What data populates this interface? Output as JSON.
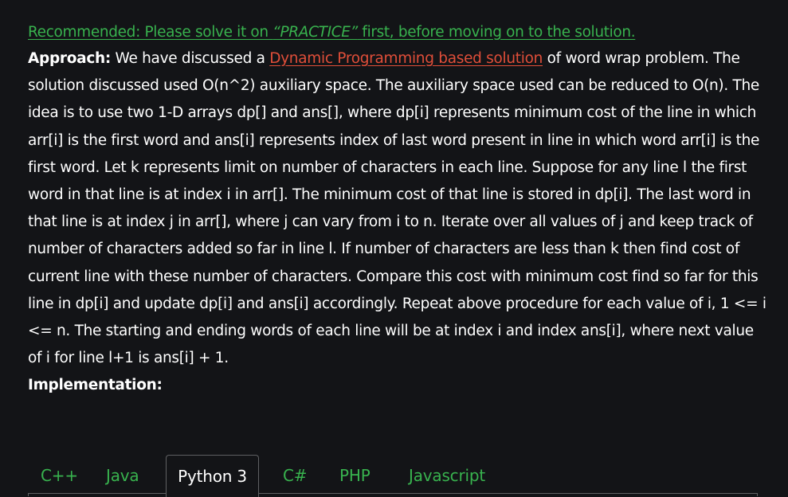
{
  "article": {
    "recommended": {
      "prefix": "Recommended: Please solve it on ",
      "emphasis": "“PRACTICE”",
      "suffix": " first, before moving on to the solution."
    },
    "approach_label": "Approach:",
    "p1_before_link": " We have discussed a ",
    "link_text": "Dynamic Programming based solution",
    "p1_after_link": " of word wrap problem. The solution discussed used O(n^2) auxiliary space. The auxiliary space used can be reduced to O(n). The idea is to use two 1-D arrays dp[] and ans[], where dp[i] represents minimum cost of the line in which arr[i] is the first word and ans[i] represents index of last word present in line in which word arr[i] is the first word. Let k represents limit on number of characters in each line. Suppose for any line l the first word in that line is at index i in arr[]. The minimum cost of that line is stored in dp[i]. The last word in that line is at index j in arr[], where j can vary from i to n. Iterate over all values of j and keep track of number of characters added so far in line l. If number of characters are less than k then find cost of current line with these number of characters. Compare this cost with minimum cost find so far for this line in dp[i] and update dp[i] and ans[i] accordingly. Repeat above procedure for each value of i, 1 <= i <= n. The starting and ending words of each line will be at index i and index ans[i], where next value of i for line l+1 is ans[i] + 1.",
    "implementation_label": "Implementation:"
  },
  "tabs": [
    {
      "label": "C++"
    },
    {
      "label": "Java"
    },
    {
      "label": "Python 3"
    },
    {
      "label": "C#"
    },
    {
      "label": "PHP"
    },
    {
      "label": "Javascript"
    }
  ],
  "active_tab": "Python 3",
  "colors": {
    "background": "#131417",
    "text": "#ffffff",
    "accent_green": "#38b24e",
    "link_red": "#e04e39",
    "tab_border": "#5f6062"
  }
}
